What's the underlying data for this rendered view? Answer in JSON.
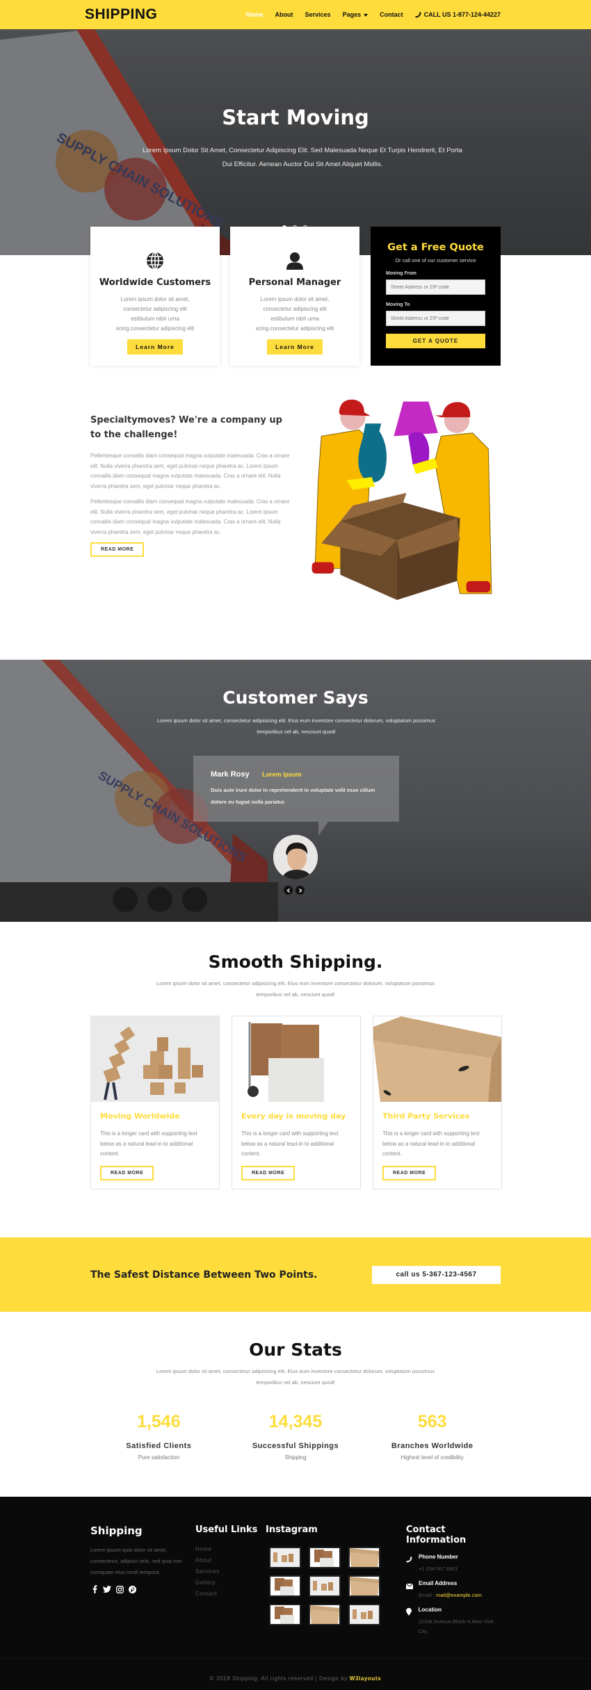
{
  "header": {
    "logo": "SHIPPING",
    "nav": [
      "Home",
      "About",
      "Services",
      "Pages",
      "Contact"
    ],
    "active_nav": "Home",
    "phone": "CALL US 1-877-124-44227",
    "accent_color": "#fedc3c"
  },
  "hero": {
    "title": "Start Moving",
    "text": "Lorem Ipsum Dolor Sit Amet, Consectetur Adipiscing Elit. Sed Malesuada Neque Et Turpis Hendrerit, Et Porta Dui Efficitur. Aenean Auctor Dui Sit Amet Aliquet Mollis.",
    "slides": 3,
    "active_slide": 1
  },
  "features": [
    {
      "icon": "globe-icon",
      "title": "Worldwide Customers",
      "text": "Lorem ipsum dolor sit amet, consectetur adipiscing elit estibulum nibh urna scing.consectetur adipiscing elit",
      "button": "Learn More"
    },
    {
      "icon": "user-icon",
      "title": "Personal Manager",
      "text": "Lorem ipsum dolor sit amet, consectetur adipiscing elit estibulum nibh urna scing.consectetur adipiscing elit",
      "button": "Learn More"
    }
  ],
  "quote": {
    "title": "Get a Free Quote",
    "subtitle": "Or call one of our customer service",
    "from_label": "Moving From",
    "from_placeholder": "Street Address or ZIP code",
    "to_label": "Moving To",
    "to_placeholder": "Street Address or ZIP code",
    "button": "GET A QUOTE"
  },
  "about": {
    "title": "Specialtymoves? We're a company up to the challenge!",
    "paragraphs": [
      "Pellentesque convallis diam consequat magna vulputate malesuada. Cras a ornare elit. Nulla viverra pharetra sem, eget pulvinar neque pharetra ac. Lorem Ipsum convallis diam consequat magna vulputate malesuada. Cras a ornare elit. Nulla viverra pharetra sem, eget pulvinar neque pharetra ac.",
      "Pellentesque convallis diam consequat magna vulputate malesuada. Cras a ornare elit. Nulla viverra pharetra sem, eget pulvinar neque pharetra ac. Lorem Ipsum convallis diam consequat magna vulputate malesuada. Cras a ornare elit. Nulla viverra pharetra sem, eget pulvinar neque pharetra ac."
    ],
    "button": "READ MORE"
  },
  "testimonials": {
    "title": "Customer Says",
    "lead": "Lorem ipsum dolor sit amet, consectetur adipisicing elit. Eius eum inventore consectetur dolorum, voluptatum possimus temporibus vel ab, nesciunt quod!",
    "name": "Mark Rosy",
    "role": "Lorem Ipsum",
    "quote": "Duis aute irure dolor in reprehenderit in voluptate velit esse cillum dolore eu fugiat nulla pariatur."
  },
  "services": {
    "title": "Smooth Shipping.",
    "lead": "Lorem ipsum dolor sit amet, consectetur adipisicing elit. Eius eum inventore consectetur dolorum, voluptatum possimus temporibus vel ab, nesciunt quod!",
    "cards": [
      {
        "title": "Moving Worldwide",
        "text": "This is a longer card with supporting text below as a natural lead-in to additional content.",
        "button": "READ MORE"
      },
      {
        "title": "Every day is moving day",
        "text": "This is a longer card with supporting text below as a natural lead-in to additional content.",
        "button": "READ MORE"
      },
      {
        "title": "Third Party Services",
        "text": "This is a longer card with supporting text below as a natural lead-in to additional content.",
        "button": "READ MORE"
      }
    ]
  },
  "banner": {
    "text": "The Safest Distance Between Two Points.",
    "button": "call us 5-367-123-4567"
  },
  "stats": {
    "title": "Our Stats",
    "lead": "Lorem ipsum dolor sit amet, consectetur adipisicing elit. Eius eum inventore consectetur dolorum, voluptatum possimus temporibus vel ab, nesciunt quod!",
    "items": [
      {
        "value": "1,546",
        "label": "Satisfied Clients",
        "sub": "Pure satisfaction"
      },
      {
        "value": "14,345",
        "label": "Successful Shippings",
        "sub": "Shipping"
      },
      {
        "value": "563",
        "label": "Branches Worldwide",
        "sub": "Highest level of credibility"
      }
    ]
  },
  "footer": {
    "brand": "Shipping",
    "about": "Lorem ipsum quia dolor sit amet, consectetur, adipisci velit, sed quia non numquam eius modi tempora.",
    "social": [
      "facebook-icon",
      "twitter-icon",
      "instagram-icon",
      "pinterest-icon"
    ],
    "links_title": "Useful Links",
    "links": [
      "Home",
      "About",
      "Services",
      "Gallery",
      "Contact"
    ],
    "instagram_title": "Instagram",
    "contact_title": "Contact Information",
    "phone_label": "Phone Number",
    "phone": "+1 234 567 8901",
    "email_label": "Email Address",
    "email_prefix": "Email :",
    "email": "mail@example.com",
    "location_label": "Location",
    "location": "1234k Avenue,Block-4,New York City.",
    "copyright": "© 2018 Shipping. All rights reserved | Design by",
    "designer": "W3layouts"
  }
}
